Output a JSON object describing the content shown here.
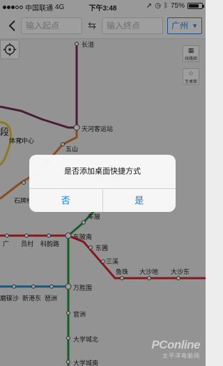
{
  "status_bar": {
    "carrier": "中国联通",
    "network": "4G",
    "time": "下午3:48",
    "battery_percent": "75%",
    "battery_level": 0.75
  },
  "search": {
    "start_placeholder": "输入起点",
    "end_placeholder": "输入终点",
    "city": "广州"
  },
  "map_controls": {
    "line_map_label": "线路图",
    "favorites_label": "至桌面"
  },
  "stations": {
    "changxi": "长湴",
    "tianhe_coach": "天河客运站",
    "sports_center": "体育中心",
    "wushan": "五山",
    "shipaiqiao": "石牌桥",
    "chebei": "车陂",
    "chebei_south": "车陂南",
    "dongpu": "东圃",
    "sanxi": "三溪",
    "yuzhu": "鱼珠",
    "dashadi": "大沙地",
    "dashadong": "大沙东",
    "wansheng": "万胜围",
    "guanzhou": "官洲",
    "university_north": "大学城北",
    "university_south": "大学城南",
    "mojingsha": "磨碟沙",
    "xinchongbei": "新港东",
    "pazhou": "琶洲",
    "yuancun": "员村",
    "kecun": "科韵路",
    "pa_partial": "广",
    "duan_partial": "段"
  },
  "dialog": {
    "message": "是否添加桌面快捷方式",
    "no_label": "否",
    "yes_label": "是"
  },
  "watermark": {
    "brand": "PConline",
    "sub": "太平洋电脑网"
  },
  "colors": {
    "accent_blue": "#1a78e6",
    "line_purple": "#7a2a5a",
    "line_orange": "#e07b2e",
    "line_red": "#d8262d",
    "line_green": "#1c9a3a",
    "line_blue": "#1f8fcf",
    "line_yellow": "#e2c62a"
  }
}
